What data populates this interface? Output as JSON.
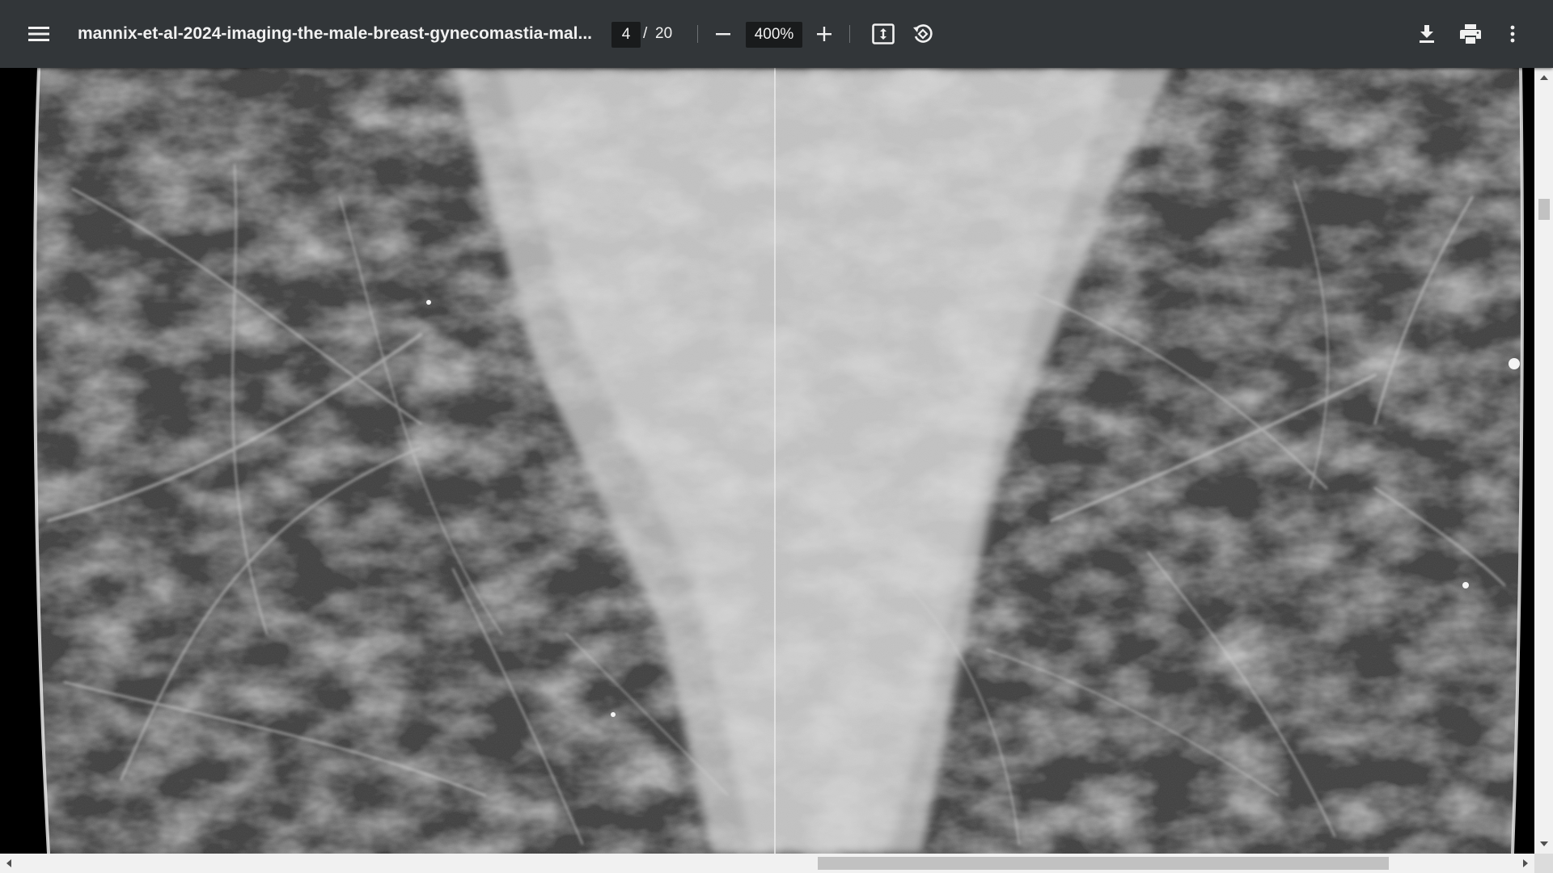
{
  "toolbar": {
    "menu_icon": "hamburger-menu-icon",
    "title": "mannix-et-al-2024-imaging-the-male-breast-gynecomastia-mal...",
    "current_page": "4",
    "page_separator": "/",
    "total_pages": "20",
    "zoom_out_icon": "minus-icon",
    "zoom_value": "400%",
    "zoom_in_icon": "plus-icon",
    "fit_page_icon": "fit-to-page-icon",
    "rotate_icon": "rotate-counterclockwise-icon",
    "download_icon": "download-icon",
    "print_icon": "print-icon",
    "more_icon": "more-vertical-icon"
  },
  "colors": {
    "toolbar_bg": "#323639",
    "toolbar_text": "#f1f1f1",
    "input_bg": "#191b1c",
    "scrollbar_track": "#f1f1f1",
    "scrollbar_thumb": "#c1c1c1"
  },
  "viewer": {
    "content": "grayscale mammogram image"
  }
}
